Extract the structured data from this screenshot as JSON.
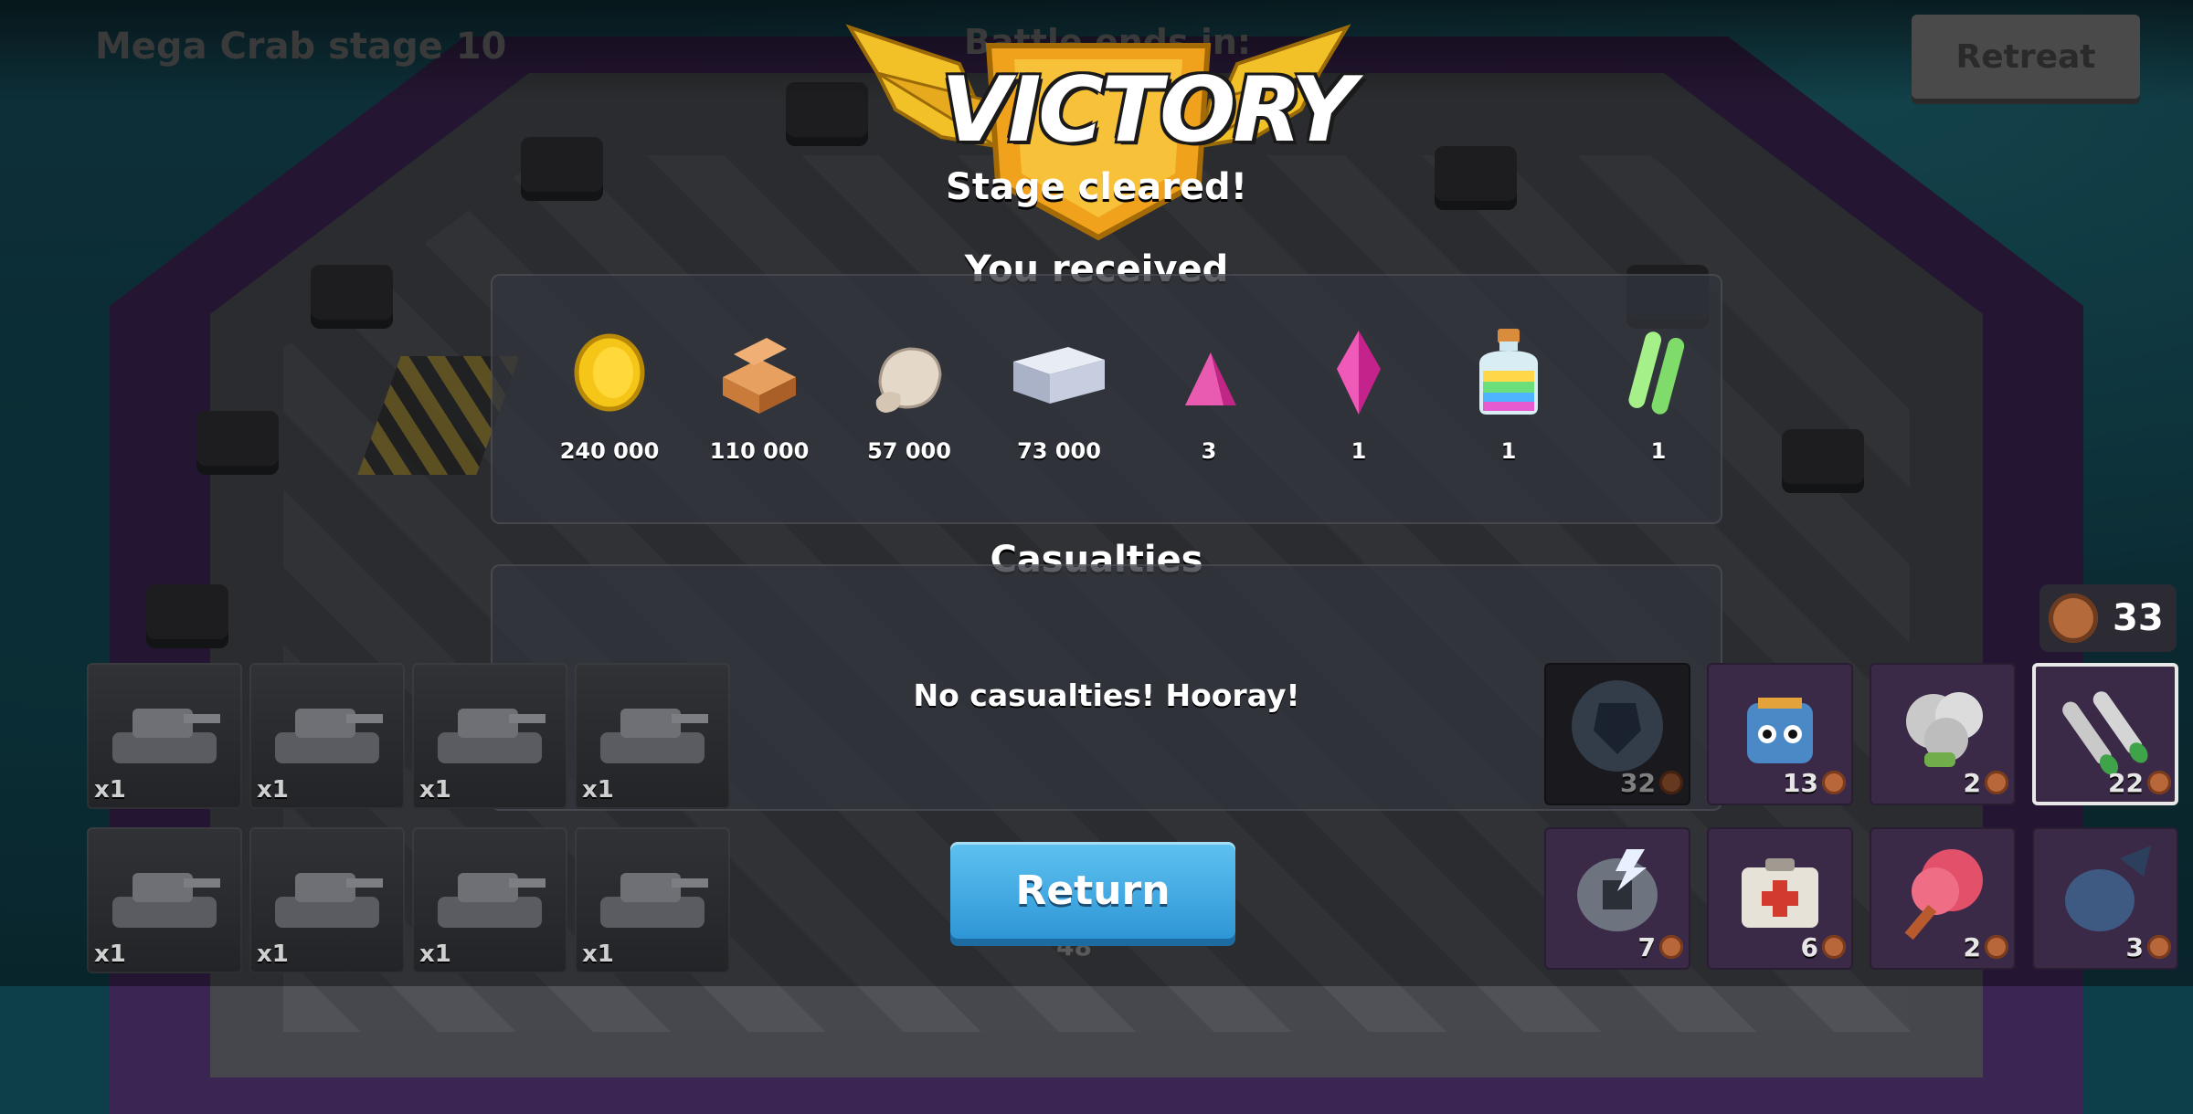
{
  "header": {
    "stage_title": "Mega Crab stage 10",
    "battle_ends": "Battle ends in:",
    "retreat_label": "Retreat"
  },
  "result": {
    "title": "VICTORY",
    "subtitle": "Stage cleared!",
    "received_label": "You received"
  },
  "rewards": [
    {
      "icon": "gold-icon",
      "value": "240 000"
    },
    {
      "icon": "wood-icon",
      "value": "110 000"
    },
    {
      "icon": "stone-icon",
      "value": "57 000"
    },
    {
      "icon": "iron-icon",
      "value": "73 000"
    },
    {
      "icon": "power-stone-icon",
      "value": "3"
    },
    {
      "icon": "crystal-icon",
      "value": "1"
    },
    {
      "icon": "elixir-icon",
      "value": "1"
    },
    {
      "icon": "glowing-tubes-icon",
      "value": "1"
    }
  ],
  "casualties": {
    "title": "Casualties",
    "message": "No casualties! Hooray!"
  },
  "return_label": "Return",
  "troops": [
    "x1",
    "x1",
    "x1",
    "x1",
    "x1",
    "x1",
    "x1",
    "x1"
  ],
  "energy": "33",
  "gunboat_counter": "48",
  "abilities": [
    {
      "icon": "shield-ability-icon",
      "cost": "32"
    },
    {
      "icon": "critters-ability-icon",
      "cost": "13"
    },
    {
      "icon": "smoke-ability-icon",
      "cost": "2"
    },
    {
      "icon": "barrage-ability-icon",
      "cost": "22"
    },
    {
      "icon": "shock-bomb-ability-icon",
      "cost": "7"
    },
    {
      "icon": "medkit-ability-icon",
      "cost": "6"
    },
    {
      "icon": "flare-ability-icon",
      "cost": "2"
    },
    {
      "icon": "artillery-ability-icon",
      "cost": "3"
    }
  ]
}
